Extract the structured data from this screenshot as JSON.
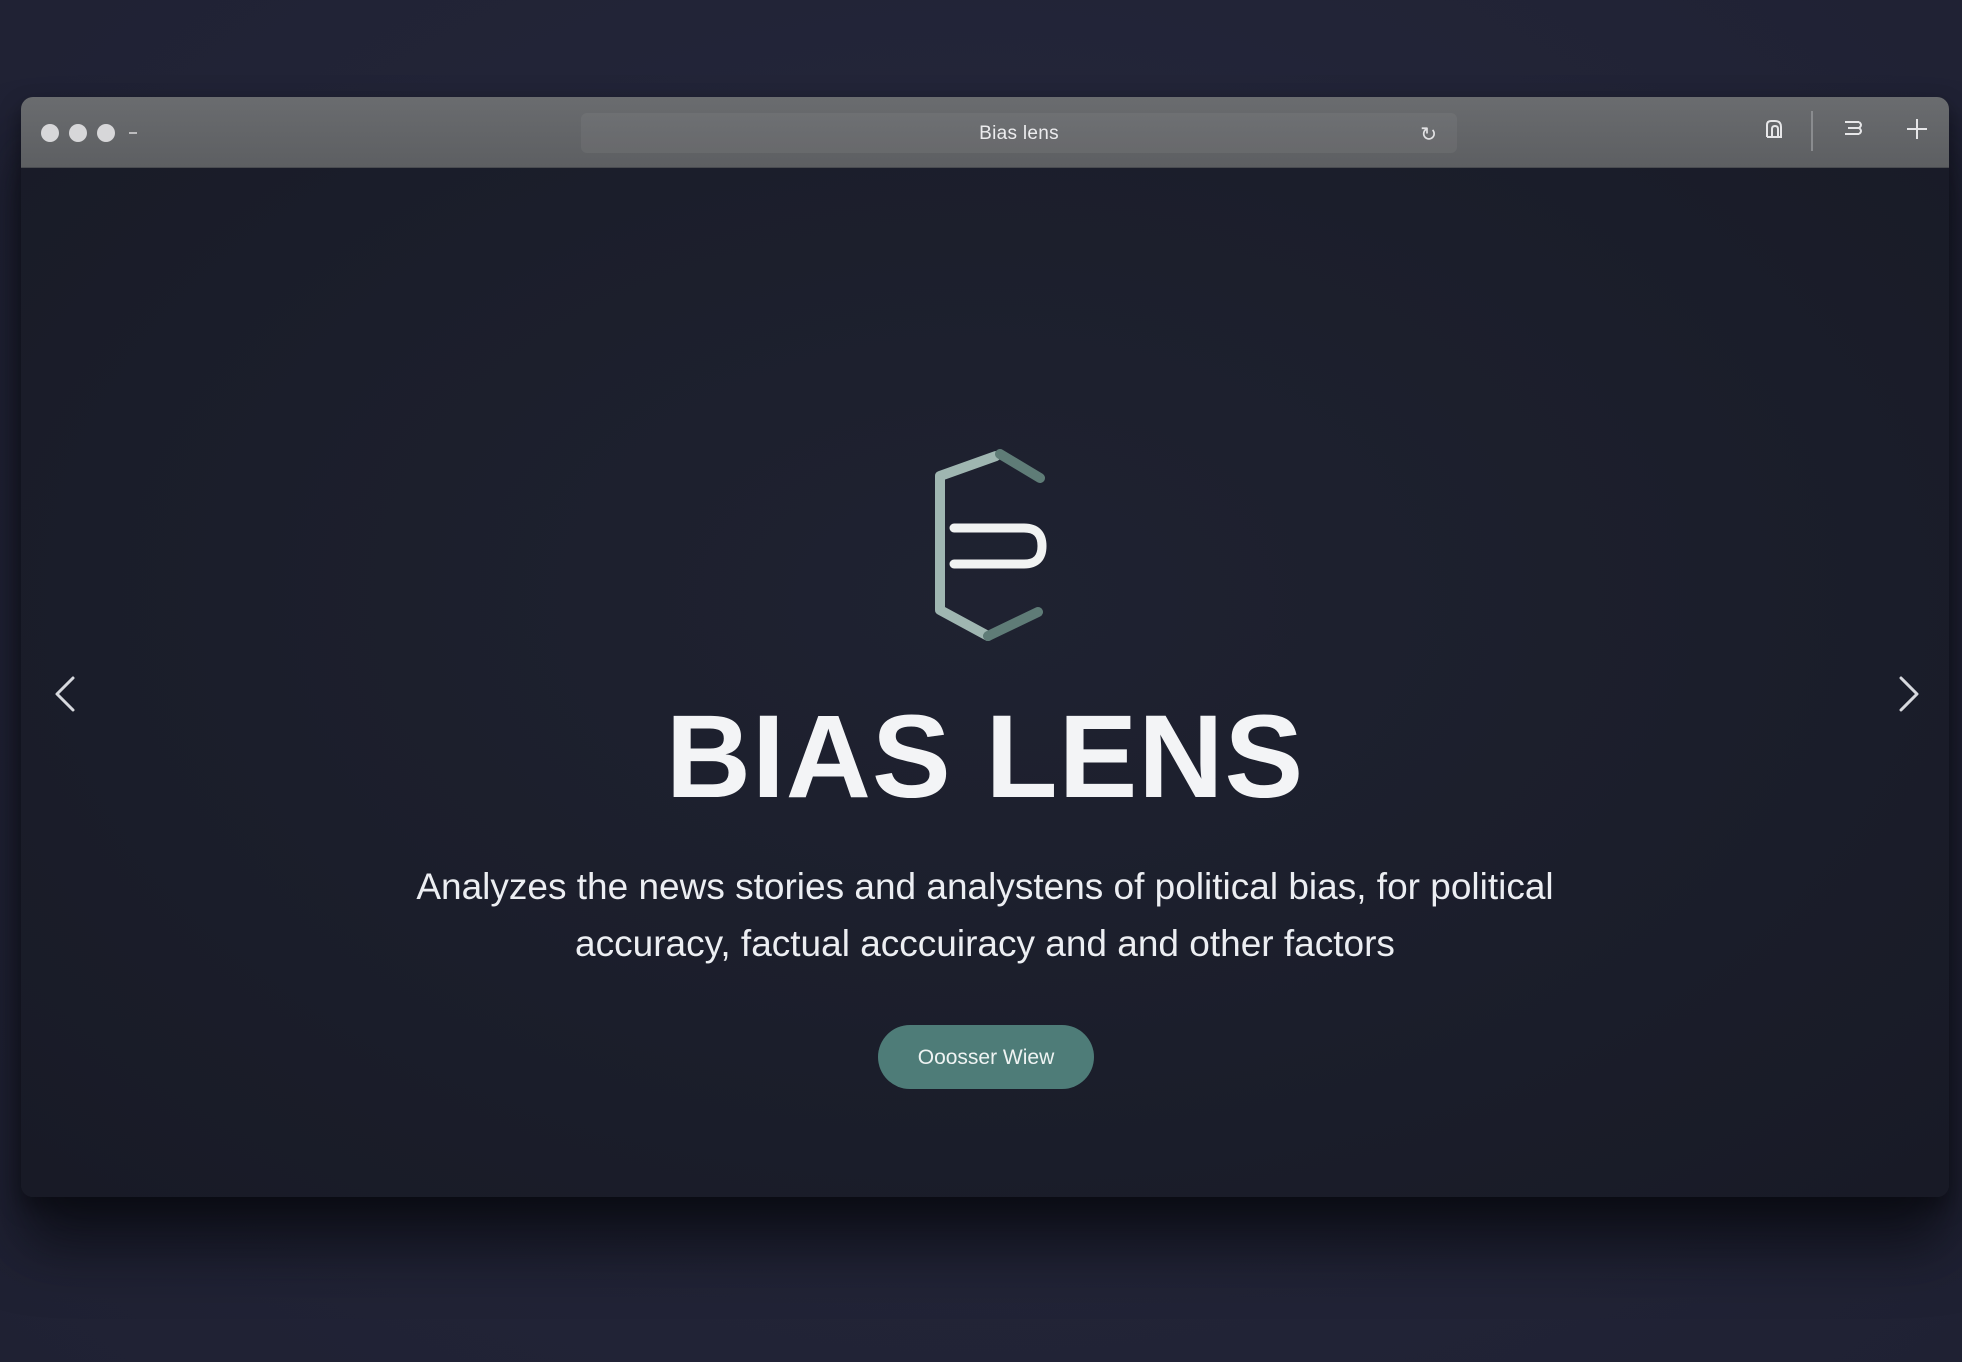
{
  "browser": {
    "title": "Bias lens",
    "reload_icon": "reload-icon",
    "toolbar_icons": [
      "share-icon",
      "sidebar-icon",
      "new-tab-icon"
    ]
  },
  "hero": {
    "logo": "bias-lens-logo",
    "headline": "BIAS LENS",
    "tagline_line1": "Analyzes the news stories and analystens of political bias, for political",
    "tagline_line2": "accuracy, factual acccuiracy and and other factors",
    "cta_label": "Ooosser Wiew"
  },
  "carousel": {
    "prev_icon": "chevron-left-icon",
    "next_icon": "chevron-right-icon",
    "pager_icon": "play-icon"
  },
  "colors": {
    "background": "#23253a",
    "window": "#1b1e2b",
    "titlebar": "#616366",
    "accent": "#4e7c78",
    "logo_light": "#9fb6b1",
    "logo_dark": "#4d6a66"
  }
}
